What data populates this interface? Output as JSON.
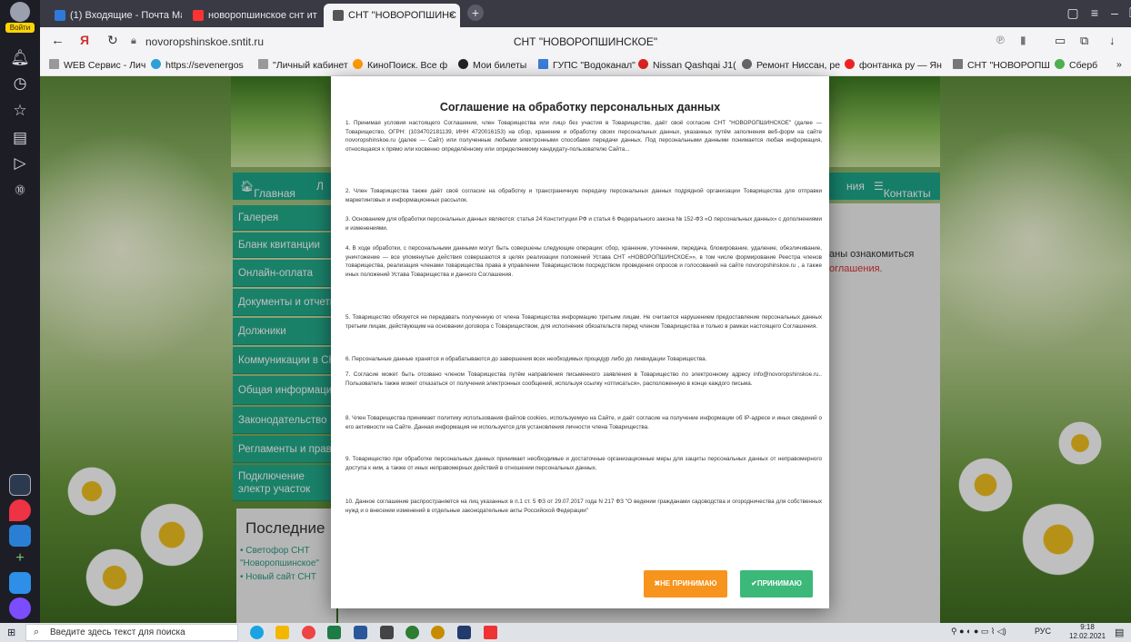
{
  "browser": {
    "tabs": [
      {
        "label": "(1) Входящие - Почта Mai"
      },
      {
        "label": "новоропшинское снт ит"
      },
      {
        "label": "СНТ \"НОВОРОПШИНС"
      }
    ],
    "url": "novoropshinskoe.sntit.ru",
    "page_title": "СНТ \"НОВОРОПШИНСКОЕ\"",
    "login_label": "Войти",
    "bookmarks": [
      "WEB Сервис - Лич",
      "https://sevenergos",
      "\"Личный кабинет",
      "КиноПоиск. Все ф",
      "Мои билеты",
      "ГУПС \"Водоканал\"",
      "Nissan Qashqai J1(",
      "Ремонт Ниссан, ре",
      "фонтанка ру — Ян",
      "СНТ \"НОВОРОПШ",
      "Сберб",
      "»"
    ]
  },
  "site": {
    "nav": [
      "Главная",
      "Л",
      "ния",
      "Контакты"
    ],
    "side_menu": [
      "Галерея",
      "Бланк квитанции",
      "Онлайн-оплата",
      "Документы и отчетн",
      "Должники",
      "Коммуникации в СН",
      "Общая информация",
      "Законодательство",
      "Регламенты и прави",
      "Подключение электр участок"
    ],
    "right_snippet_1": "аны ознакомиться",
    "right_snippet_2": "оглашения.",
    "news_heading": "Последние",
    "news": [
      "• Светофор СНТ \"Новоропшинское\"",
      "• Новый сайт СНТ"
    ]
  },
  "modal": {
    "title": "Соглашение на обработку персональных данных",
    "paragraphs": [
      "1. Принимая условия настоящего Соглашения, член Товарищества или лицо без участия в Товариществе, даёт своё согласие СНТ \"НОВОРОПШИНСКОЕ\" (далее — Товарищество, ОГРН: (1034702181139, ИНН 4720016153) на сбор, хранение и обработку своих персональных данных, указанных путём заполнения веб-форм на сайте novoropshinskoe.ru (далее — Сайт) или полученные любыми электронными способами передачи данных. Под персональными данными понимается любая информация, относящаяся к прямо или косвенно определённому или определяемому кандидату-пользователю Сайта...",
      "2. Член Товарищества также даёт своё согласие на обработку и трансграничную передачу персональных данных подрядной организации Товарищества для отправки маркетинговых и информационных рассылок.",
      "3. Основанием для обработки персональных данных являются: статья 24 Конституции РФ и статья 6 Федерального закона № 152-ФЗ «О персональных данных» с дополнениями и изменениями.",
      "4. В ходе обработки, с персональными данными могут быть совершены следующие операции: сбор, хранение, уточнение, передача, блокирование, удаление, обезличивание, уничтожение — все упомянутые действия совершаются в целях реализации положений Устава СНТ «НОВОРОПШИНСКОЕ»», в том числе формирование Реестра членов товарищества, реализация членами товарищества права в управлении Товариществом посредством проведения опросов и голосований на сайте novoropshinskoe.ru , а также иных положений Устава Товарищества и данного Соглашения.",
      "5. Товарищество обязуется не передавать полученную от члена Товарищества информацию третьим лицам. Не считается нарушением предоставление персональных данных третьим лицам, действующим на основании договора с Товариществом, для исполнения обязательств перед членом Товарищества и только в рамках настоящего Соглашения.",
      "6. Персональные данные хранятся и обрабатываются до завершения всех необходимых процедур либо до ликвидации Товарищества.",
      "7. Согласие может быть отозвано членом Товарищества путём направления письменного заявления в Товарищество по электронному адресу info@novoropshinskoe.ru.. Пользователь также может отказаться от получения электронных сообщений, используя ссылку «отписаться», расположенную в конце каждого письма.",
      "8. Член Товарищества принимает политику использования файлов cookies, используемую на Сайте, и даёт согласие на получение информации об IP-адресе и иных сведений о его активности на Сайте. Данная информация не используется для установления личности члена Товарищества.",
      "9. Товарищество при обработке персональных данных принимает необходимые и достаточные организационные меры для защиты персональных данных от неправомерного доступа к ним, а также от иных неправомерных действий в отношении персональных данных.",
      "10. Данное соглашение распространяется на лиц указанных в п.1 ст. 5 ФЗ от 29.07.2017 года N 217 ФЗ \"О ведении гражданами садоводства и огородничества для собственных нужд и о внесении изменений в отдельные законодательные акты Российской Федерации\""
    ],
    "decline_label": "✖НЕ ПРИНИМАЮ",
    "accept_label": "✔ПРИНИМАЮ",
    "decline_color": "#f7941d",
    "accept_color": "#3cb878"
  },
  "taskbar": {
    "search_placeholder": "Введите здесь текст для поиска",
    "lang": "РУС",
    "time": "9:18",
    "date": "12.02.2021"
  }
}
